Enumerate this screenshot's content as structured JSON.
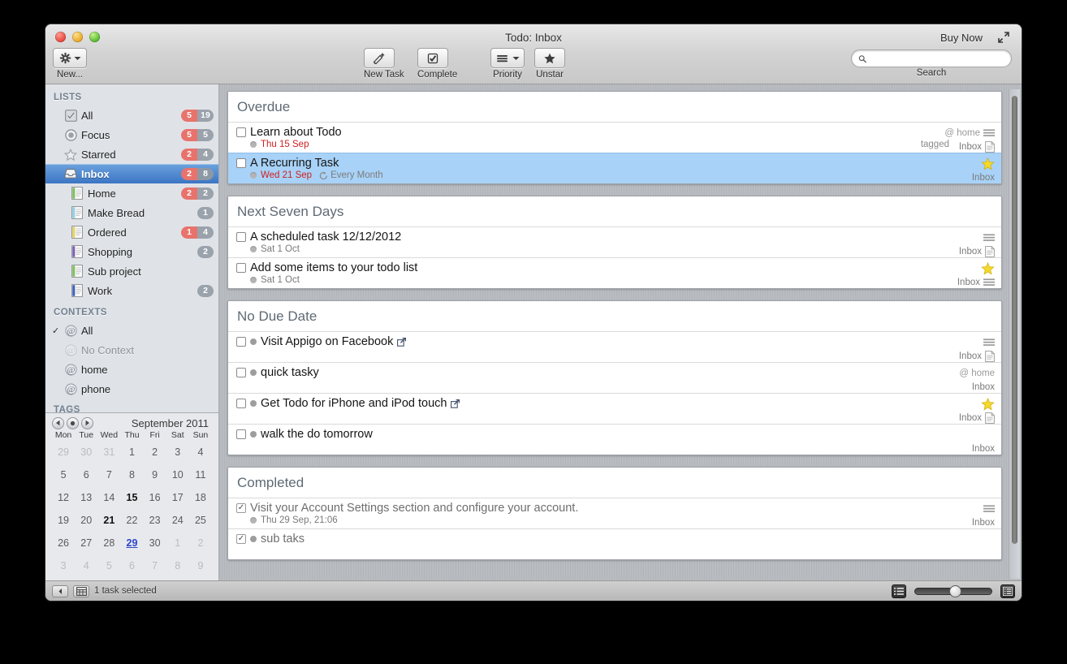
{
  "window": {
    "title": "Todo: Inbox",
    "buy_now": "Buy Now"
  },
  "toolbar": {
    "new_label": "New...",
    "new_task_label": "New Task",
    "complete_label": "Complete",
    "priority_label": "Priority",
    "unstar_label": "Unstar",
    "search_placeholder": "",
    "search_value": "",
    "search_caption": "Search"
  },
  "sidebar": {
    "lists_header": "LISTS",
    "contexts_header": "CONTEXTS",
    "tags_header": "TAGS",
    "lists": [
      {
        "label": "All",
        "icon": "all-icon",
        "red": "5",
        "gray": "19",
        "selected": false,
        "indent": 1
      },
      {
        "label": "Focus",
        "icon": "focus-icon",
        "red": "5",
        "gray": "5",
        "selected": false,
        "indent": 1
      },
      {
        "label": "Starred",
        "icon": "star-icon",
        "red": "2",
        "gray": "4",
        "selected": false,
        "indent": 1
      },
      {
        "label": "Inbox",
        "icon": "inbox-icon",
        "red": "2",
        "gray": "8",
        "selected": true,
        "indent": 1
      },
      {
        "label": "Home",
        "icon": "list-icon",
        "red": "2",
        "gray": "2",
        "selected": false,
        "indent": 2,
        "color": "#7dbf5c"
      },
      {
        "label": "Make Bread",
        "icon": "list-icon",
        "red": "",
        "gray": "1",
        "selected": false,
        "indent": 2,
        "color": "#8fd0e8"
      },
      {
        "label": "Ordered",
        "icon": "list-icon",
        "red": "1",
        "gray": "4",
        "selected": false,
        "indent": 2,
        "color": "#e6d25c"
      },
      {
        "label": "Shopping",
        "icon": "list-icon",
        "red": "",
        "gray": "2",
        "selected": false,
        "indent": 2,
        "color": "#7a5fb5"
      },
      {
        "label": "Sub project",
        "icon": "list-icon",
        "red": "",
        "gray": "",
        "selected": false,
        "indent": 2,
        "color": "#7dbf5c"
      },
      {
        "label": "Work",
        "icon": "list-icon",
        "red": "",
        "gray": "2",
        "selected": false,
        "indent": 2,
        "color": "#3f5fbf"
      }
    ],
    "contexts": [
      {
        "label": "All",
        "checked": true,
        "dim": false
      },
      {
        "label": "No Context",
        "checked": false,
        "dim": true
      },
      {
        "label": "home",
        "checked": false,
        "dim": false
      },
      {
        "label": "phone",
        "checked": false,
        "dim": false
      }
    ]
  },
  "calendar": {
    "month_label": "September 2011",
    "dow": [
      "Mon",
      "Tue",
      "Wed",
      "Thu",
      "Fri",
      "Sat",
      "Sun"
    ],
    "weeks": [
      [
        {
          "d": "29",
          "s": "out"
        },
        {
          "d": "30",
          "s": "out"
        },
        {
          "d": "31",
          "s": "out"
        },
        {
          "d": "1",
          "s": ""
        },
        {
          "d": "2",
          "s": ""
        },
        {
          "d": "3",
          "s": ""
        },
        {
          "d": "4",
          "s": ""
        }
      ],
      [
        {
          "d": "5",
          "s": ""
        },
        {
          "d": "6",
          "s": ""
        },
        {
          "d": "7",
          "s": ""
        },
        {
          "d": "8",
          "s": ""
        },
        {
          "d": "9",
          "s": ""
        },
        {
          "d": "10",
          "s": ""
        },
        {
          "d": "11",
          "s": ""
        }
      ],
      [
        {
          "d": "12",
          "s": ""
        },
        {
          "d": "13",
          "s": ""
        },
        {
          "d": "14",
          "s": ""
        },
        {
          "d": "15",
          "s": "bold"
        },
        {
          "d": "16",
          "s": ""
        },
        {
          "d": "17",
          "s": ""
        },
        {
          "d": "18",
          "s": ""
        }
      ],
      [
        {
          "d": "19",
          "s": ""
        },
        {
          "d": "20",
          "s": ""
        },
        {
          "d": "21",
          "s": "bold"
        },
        {
          "d": "22",
          "s": ""
        },
        {
          "d": "23",
          "s": ""
        },
        {
          "d": "24",
          "s": ""
        },
        {
          "d": "25",
          "s": ""
        }
      ],
      [
        {
          "d": "26",
          "s": ""
        },
        {
          "d": "27",
          "s": ""
        },
        {
          "d": "28",
          "s": ""
        },
        {
          "d": "29",
          "s": "today"
        },
        {
          "d": "30",
          "s": ""
        },
        {
          "d": "1",
          "s": "out"
        },
        {
          "d": "2",
          "s": "out"
        }
      ],
      [
        {
          "d": "3",
          "s": "out"
        },
        {
          "d": "4",
          "s": "out"
        },
        {
          "d": "5",
          "s": "out"
        },
        {
          "d": "6",
          "s": "out"
        },
        {
          "d": "7",
          "s": "out"
        },
        {
          "d": "8",
          "s": "out"
        },
        {
          "d": "9",
          "s": "out"
        }
      ]
    ]
  },
  "groups": [
    {
      "title": "Overdue",
      "tasks": [
        {
          "title": "Learn about Todo",
          "checked": false,
          "selected": false,
          "sub_dot": false,
          "link": false,
          "due": "Thu 15 Sep",
          "due_class": "",
          "recur": "",
          "context": "@ home",
          "tag": "tagged",
          "list": "Inbox",
          "priority": true,
          "star": false,
          "note": true
        },
        {
          "title": "A Recurring Task",
          "checked": false,
          "selected": true,
          "sub_dot": false,
          "link": false,
          "due": "Wed 21 Sep",
          "due_class": "",
          "recur": "Every Month",
          "context": "",
          "tag": "",
          "list": "Inbox",
          "priority": false,
          "star": true,
          "note": false
        }
      ]
    },
    {
      "title": "Next Seven Days",
      "tasks": [
        {
          "title": "A scheduled task 12/12/2012",
          "checked": false,
          "selected": false,
          "sub_dot": false,
          "link": false,
          "due": "Sat 1 Oct",
          "due_class": "future",
          "recur": "",
          "context": "",
          "tag": "",
          "list": "Inbox",
          "priority": true,
          "star": false,
          "note": true
        },
        {
          "title": "Add some items to your todo list",
          "checked": false,
          "selected": false,
          "sub_dot": false,
          "link": false,
          "due": "Sat 1 Oct",
          "due_class": "future",
          "recur": "",
          "context": "",
          "tag": "",
          "list": "Inbox",
          "priority": true,
          "star": true,
          "note": false
        }
      ]
    },
    {
      "title": "No Due Date",
      "tasks": [
        {
          "title": "Visit Appigo on Facebook",
          "checked": false,
          "selected": false,
          "sub_dot": true,
          "link": true,
          "due": "",
          "due_class": "",
          "recur": "",
          "context": "",
          "tag": "",
          "list": "Inbox",
          "priority": true,
          "star": false,
          "note": true
        },
        {
          "title": "quick tasky",
          "checked": false,
          "selected": false,
          "sub_dot": true,
          "link": false,
          "due": "",
          "due_class": "",
          "recur": "",
          "context": "@ home",
          "tag": "",
          "list": "Inbox",
          "priority": false,
          "star": false,
          "note": false
        },
        {
          "title": "Get Todo for iPhone and iPod touch",
          "checked": false,
          "selected": false,
          "sub_dot": true,
          "link": true,
          "due": "",
          "due_class": "",
          "recur": "",
          "context": "",
          "tag": "",
          "list": "Inbox",
          "priority": false,
          "star": true,
          "note": true
        },
        {
          "title": "walk the do tomorrow",
          "checked": false,
          "selected": false,
          "sub_dot": true,
          "link": false,
          "due": "",
          "due_class": "",
          "recur": "",
          "context": "",
          "tag": "",
          "list": "Inbox",
          "priority": false,
          "star": false,
          "note": false
        }
      ]
    },
    {
      "title": "Completed",
      "tasks": [
        {
          "title": "Visit your Account Settings section and configure your account.",
          "checked": true,
          "selected": false,
          "done": true,
          "sub_dot": false,
          "link": false,
          "due": "Thu 29 Sep, 21:06",
          "due_class": "doneclr",
          "recur": "",
          "context": "",
          "tag": "",
          "list": "Inbox",
          "priority": true,
          "star": false,
          "note": false
        },
        {
          "title": "sub taks",
          "checked": true,
          "selected": false,
          "done": true,
          "sub_dot": true,
          "link": false,
          "due": "",
          "due_class": "",
          "recur": "",
          "context": "",
          "tag": "",
          "list": "",
          "priority": false,
          "star": false,
          "note": false
        }
      ]
    }
  ],
  "statusbar": {
    "text": "1 task selected"
  }
}
